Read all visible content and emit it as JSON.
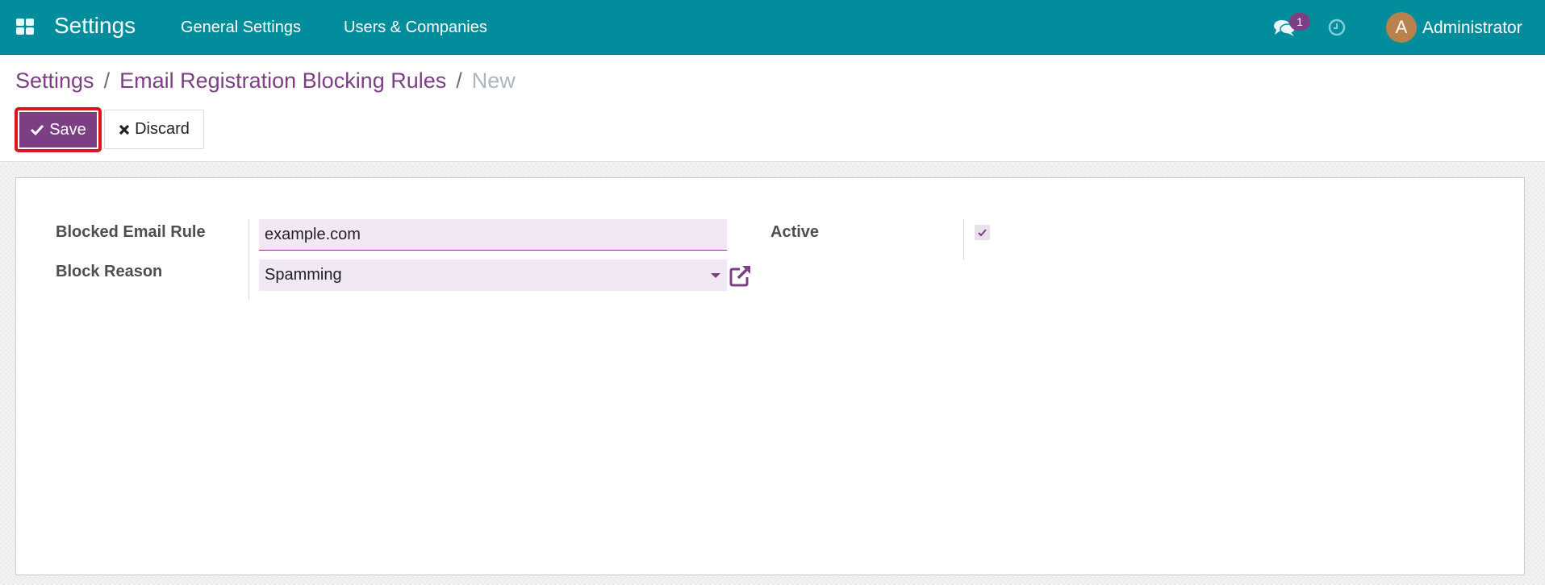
{
  "navbar": {
    "app_title": "Settings",
    "menu": [
      "General Settings",
      "Users & Companies"
    ],
    "messages_badge": "1",
    "user": {
      "avatar_initial": "A",
      "name": "Administrator"
    },
    "icons": {
      "apps": "apps-grid-icon",
      "messages": "chat-bubbles-icon",
      "activities": "clock-icon"
    },
    "colors": {
      "navbar_bg": "#018d9c",
      "badge_bg": "#7c3f84",
      "avatar_bg": "#b8824c"
    }
  },
  "breadcrumb": {
    "items": [
      "Settings",
      "Email Registration Blocking Rules"
    ],
    "separator": "/",
    "current": "New"
  },
  "toolbar": {
    "save_label": "Save",
    "discard_label": "Discard",
    "colors": {
      "primary": "#7c3f84",
      "highlight": "#e0141c"
    }
  },
  "form": {
    "fields": {
      "blocked_email_rule": {
        "label": "Blocked Email Rule",
        "value": "example.com"
      },
      "block_reason": {
        "label": "Block Reason",
        "value": "Spamming"
      },
      "active": {
        "label": "Active",
        "checked": true
      }
    }
  }
}
